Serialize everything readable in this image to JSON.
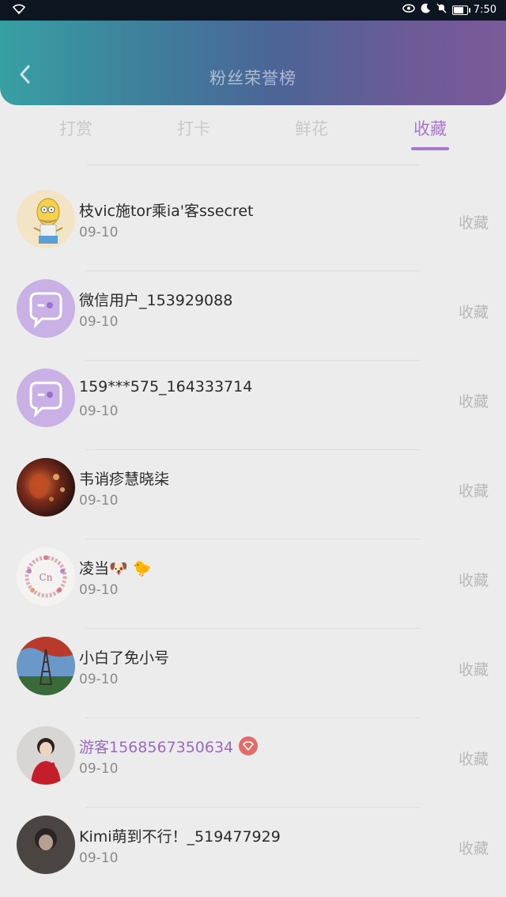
{
  "status_bar": {
    "time": "7:50"
  },
  "header": {
    "title": "粉丝荣誉榜"
  },
  "tabs": [
    {
      "label": "打赏",
      "active": false
    },
    {
      "label": "打卡",
      "active": false
    },
    {
      "label": "鲜花",
      "active": false
    },
    {
      "label": "收藏",
      "active": true
    }
  ],
  "colors": {
    "accent": "#a778c9",
    "header_start": "#37a0a3",
    "header_end": "#7b5a9a"
  },
  "fans": [
    {
      "name": "枝vic施tor乘ia'客ssecret",
      "date": "09-10",
      "action": "收藏",
      "avatar": "simpson-avatar"
    },
    {
      "name": "微信用户_153929088",
      "date": "09-10",
      "action": "收藏",
      "avatar": "default-chat-avatar"
    },
    {
      "name": "159***575_164333714",
      "date": "09-10",
      "action": "收藏",
      "avatar": "default-chat-avatar"
    },
    {
      "name": "韦诮疹慧晓柒",
      "date": "09-10",
      "action": "收藏",
      "avatar": "lantern-photo-avatar"
    },
    {
      "name": "凌当🐶 🐤",
      "date": "09-10",
      "action": "收藏",
      "avatar": "flower-wreath-avatar"
    },
    {
      "name": "小白了免小号",
      "date": "09-10",
      "action": "收藏",
      "avatar": "eiffel-tower-avatar"
    },
    {
      "name": "游客1568567350634",
      "date": "09-10",
      "action": "收藏",
      "avatar": "person-photo-avatar",
      "vip": true
    },
    {
      "name": "Kimi萌到不行！_519477929",
      "date": "09-10",
      "action": "收藏",
      "avatar": "dark-photo-avatar"
    }
  ]
}
